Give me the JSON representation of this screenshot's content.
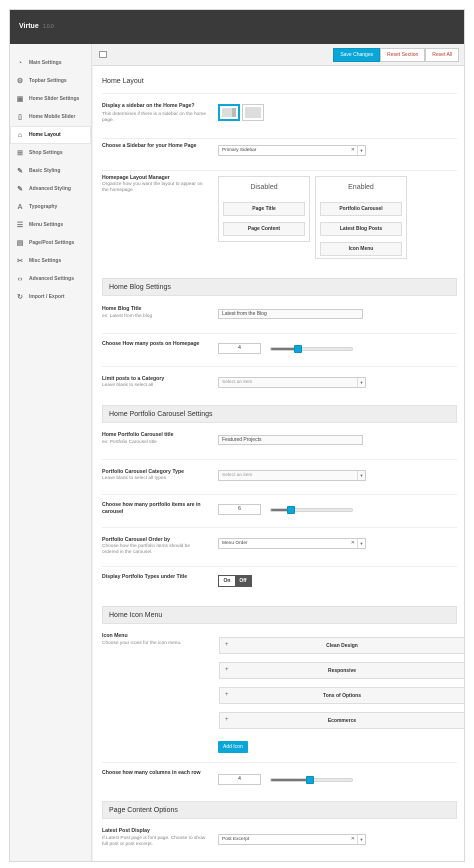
{
  "app": {
    "title": "Virtue",
    "version": "1.0.0"
  },
  "sidebar": {
    "items": [
      {
        "label": "Main Settings",
        "icon": "dashboard-icon"
      },
      {
        "label": "Topbar Settings",
        "icon": "gear-icon"
      },
      {
        "label": "Home Slider Settings",
        "icon": "image-icon"
      },
      {
        "label": "Home Mobile Slider",
        "icon": "tablet-icon"
      },
      {
        "label": "Home Layout",
        "icon": "home-icon",
        "active": true
      },
      {
        "label": "Shop Settings",
        "icon": "cart-icon"
      },
      {
        "label": "Basic Styling",
        "icon": "pencil-icon"
      },
      {
        "label": "Advanced Styling",
        "icon": "pencil-icon"
      },
      {
        "label": "Typography",
        "icon": "text-icon"
      },
      {
        "label": "Menu Settings",
        "icon": "list-icon"
      },
      {
        "label": "Page/Post Settings",
        "icon": "page-icon"
      },
      {
        "label": "Misc Settings",
        "icon": "wrench-icon"
      },
      {
        "label": "Advanced Settings",
        "icon": "code-icon"
      },
      {
        "label": "Import / Export",
        "icon": "refresh-icon"
      }
    ]
  },
  "toolbar": {
    "save": "Save Changes",
    "reset_section": "Reset Section",
    "reset_all": "Reset All"
  },
  "home_layout": {
    "heading": "Home Layout",
    "sidebar_display": {
      "label": "Display a sidebar on the Home Page?",
      "desc": "This determines if there is a sidebar on the home page."
    },
    "choose_sidebar": {
      "label": "Choose a Sidebar for your Home Page",
      "value": "Primary Sidebar"
    },
    "manager": {
      "label": "Homepage Layout Manager",
      "desc": "Organize how you want the layout to appear on the homepage",
      "disabled_title": "Disabled",
      "disabled_items": [
        "Page Title",
        "Page Content"
      ],
      "enabled_title": "Enabled",
      "enabled_items": [
        "Portfolio Carousel",
        "Latest Blog Posts",
        "Icon Menu"
      ]
    }
  },
  "blog": {
    "heading": "Home Blog Settings",
    "title_label": "Home Blog Title",
    "title_desc": "ex: Latest from the blog",
    "title_value": "Latest from the Blog",
    "posts_label": "Choose How many posts on Homepage",
    "posts_value": "4",
    "posts_fraction": 0.33,
    "category_label": "Limit posts to a Category",
    "category_desc": "Leave blank to select all",
    "category_placeholder": "Select an item"
  },
  "portfolio": {
    "heading": "Home Portfolio Carousel Settings",
    "title_label": "Home Portfolio Carousel title",
    "title_desc": "ex: Portfolio Carousel title",
    "title_value": "Featured Projects",
    "cat_label": "Portfolio Carousel Category Type",
    "cat_desc": "Leave blank to select all types",
    "cat_placeholder": "Select an item",
    "items_label": "Choose how many portfolio items are in carousel",
    "items_value": "6",
    "items_fraction": 0.25,
    "order_label": "Portfolio Carousel Order by",
    "order_desc": "Choose how the portfolio items should be ordered in the carousel.",
    "order_value": "Menu Order",
    "types_label": "Display Portfolio Types under Title",
    "toggle_on": "On",
    "toggle_off": "Off"
  },
  "icon_menu": {
    "heading": "Home Icon Menu",
    "label": "Icon Menu",
    "desc": "Choose your icons for the icon menu.",
    "items": [
      "Clean Design",
      "Responsive",
      "Tons of Options",
      "Ecommerce"
    ],
    "add": "Add Icon",
    "columns_label": "Choose how many columns in each row",
    "columns_value": "4",
    "columns_fraction": 0.48
  },
  "page_content": {
    "heading": "Page Content Options",
    "label": "Latest Post Display",
    "desc": "If Latest Post page is font page. Choose to show full post or post excerpt.",
    "value": "Post Excerpt"
  },
  "colors": {
    "accent": "#0ba6d8",
    "topbar": "#3a3a3a"
  }
}
